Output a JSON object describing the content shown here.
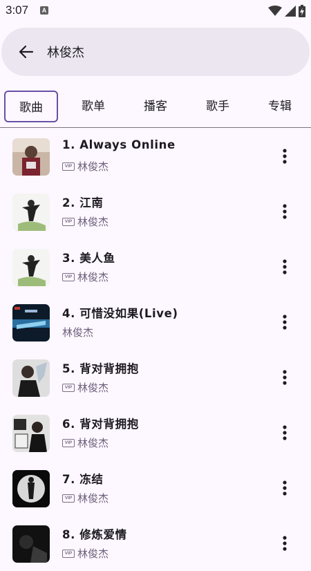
{
  "status_bar": {
    "time": "3:07",
    "notification_icon": "a-box-icon",
    "wifi_icon": "wifi-icon",
    "signal_icon": "cell-signal-icon",
    "battery_icon": "battery-charging-icon"
  },
  "search": {
    "back_icon": "arrow-left-icon",
    "query": "林俊杰"
  },
  "tabs": [
    {
      "label": "歌曲",
      "selected": true
    },
    {
      "label": "歌单",
      "selected": false
    },
    {
      "label": "播客",
      "selected": false
    },
    {
      "label": "歌手",
      "selected": false
    },
    {
      "label": "专辑",
      "selected": false
    }
  ],
  "songs": [
    {
      "title": "1. Always Online",
      "artist": "林俊杰",
      "vip": true
    },
    {
      "title": "2. 江南",
      "artist": "林俊杰",
      "vip": true
    },
    {
      "title": "3. 美人鱼",
      "artist": "林俊杰",
      "vip": true
    },
    {
      "title": "4. 可惜没如果(Live)",
      "artist": "林俊杰",
      "vip": false
    },
    {
      "title": "5. 背对背拥抱",
      "artist": "林俊杰",
      "vip": true
    },
    {
      "title": "6. 背对背拥抱",
      "artist": "林俊杰",
      "vip": true
    },
    {
      "title": "7. 冻结",
      "artist": "林俊杰",
      "vip": true
    },
    {
      "title": "8. 修炼爱情",
      "artist": "林俊杰",
      "vip": true
    }
  ],
  "vip_label": "VIP",
  "colors": {
    "background": "#fdf7ff",
    "search_bar": "#ece6f0",
    "accent": "#6750a4",
    "secondary_text": "#6a607a"
  }
}
